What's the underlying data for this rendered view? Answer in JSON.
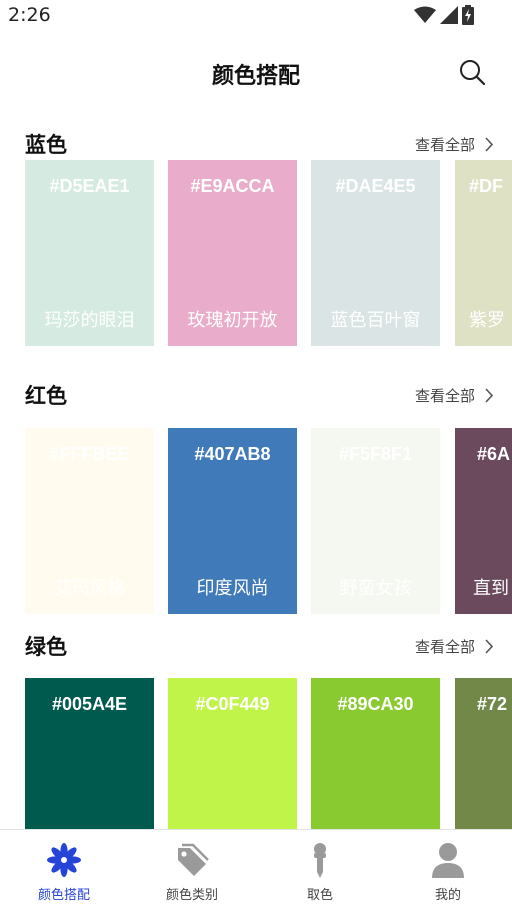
{
  "status": {
    "time": "2:26"
  },
  "header": {
    "title": "颜色搭配",
    "search_icon": "search-icon"
  },
  "sections": [
    {
      "title": "蓝色",
      "view_all": "查看全部",
      "cards": [
        {
          "hex": "#D5EAE1",
          "name": "玛莎的眼泪",
          "color": "#D5EAE1"
        },
        {
          "hex": "#E9ACCA",
          "name": "玫瑰初开放",
          "color": "#E9ACCA"
        },
        {
          "hex": "#DAE4E5",
          "name": "蓝色百叶窗",
          "color": "#DAE4E5"
        },
        {
          "hex": "#DF",
          "name": "紫罗",
          "color": "#DFE1C4"
        }
      ]
    },
    {
      "title": "红色",
      "view_all": "查看全部",
      "cards": [
        {
          "hex": "#FFFBEE",
          "name": "艾玛风格",
          "color": "#FFFBEE"
        },
        {
          "hex": "#407AB8",
          "name": "印度风尚",
          "color": "#407AB8"
        },
        {
          "hex": "#F5F8F1",
          "name": "野蛮女孩",
          "color": "#F5F8F1"
        },
        {
          "hex": "#6A",
          "name": "直到",
          "color": "#6A4A5C"
        }
      ]
    },
    {
      "title": "绿色",
      "view_all": "查看全部",
      "cards": [
        {
          "hex": "#005A4E",
          "name": "",
          "color": "#005A4E"
        },
        {
          "hex": "#C0F449",
          "name": "",
          "color": "#C0F449"
        },
        {
          "hex": "#89CA30",
          "name": "",
          "color": "#89CA30"
        },
        {
          "hex": "#72",
          "name": "",
          "color": "#728848"
        }
      ]
    }
  ],
  "tabs": [
    {
      "label": "颜色搭配",
      "icon": "flower-icon",
      "active": true
    },
    {
      "label": "颜色类别",
      "icon": "tags-icon",
      "active": false
    },
    {
      "label": "取色",
      "icon": "eyedropper-icon",
      "active": false
    },
    {
      "label": "我的",
      "icon": "person-icon",
      "active": false
    }
  ],
  "colors": {
    "accent": "#2545D6",
    "inactive_icon": "#9a9a9a"
  }
}
